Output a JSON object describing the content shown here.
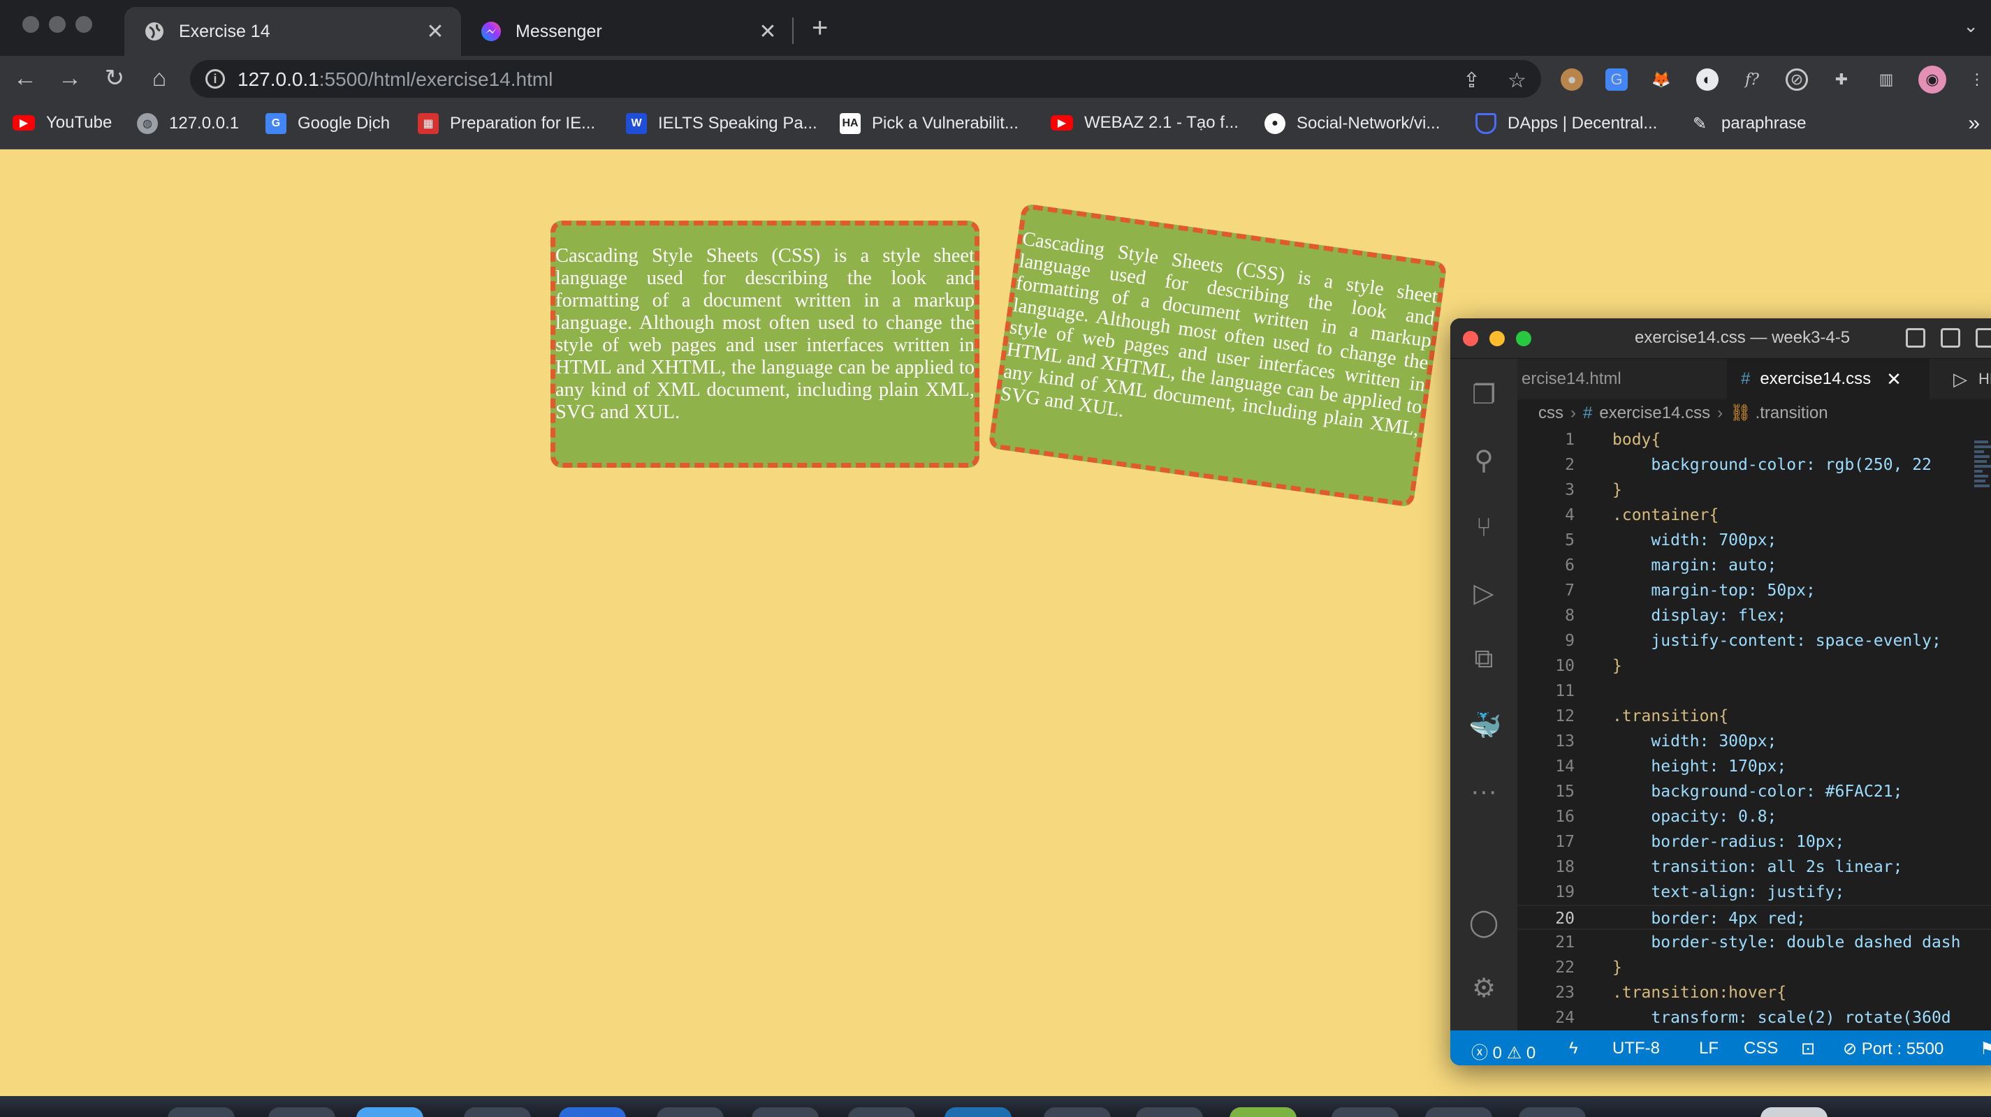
{
  "browser": {
    "tabs": [
      {
        "title": "Exercise 14",
        "icon": "globe-icon",
        "active": true
      },
      {
        "title": "Messenger",
        "icon": "messenger-icon",
        "active": false
      }
    ],
    "url": {
      "host": "127.0.0.1",
      "rest": ":5500/html/exercise14.html"
    },
    "bookmarks": [
      {
        "label": "YouTube",
        "icon": "youtube-icon",
        "color": "#ff0000"
      },
      {
        "label": "127.0.0.1",
        "icon": "globe-icon",
        "color": "#9aa0a6"
      },
      {
        "label": "Google Dịch",
        "icon": "google-translate-icon",
        "color": "#4285f4"
      },
      {
        "label": "Preparation for IE...",
        "icon": "ielts-icon",
        "color": "#d6322f"
      },
      {
        "label": "IELTS Speaking Pa...",
        "icon": "ielts-speaking-icon",
        "color": "#1f4fd8"
      },
      {
        "label": "Pick a Vulnerabilit...",
        "icon": "hacker-icon",
        "color": "#ffffff"
      },
      {
        "label": "WEBAZ 2.1 - Tạo f...",
        "icon": "youtube-icon",
        "color": "#ff0000"
      },
      {
        "label": "Social-Network/vi...",
        "icon": "github-icon",
        "color": "#ffffff"
      },
      {
        "label": "DApps | Decentral...",
        "icon": "shield-icon",
        "color": "#4a6cf7"
      },
      {
        "label": "paraphrase",
        "icon": "pen-icon",
        "color": "#e8eaed"
      }
    ]
  },
  "page": {
    "card_text": "Cascading Style Sheets (CSS) is a style sheet language used for describing the look and formatting of a document written in a markup language. Although most often used to change the style of web pages and user interfaces written in HTML and XHTML, the language can be applied to any kind of XML document, including plain XML, SVG and XUL.",
    "background": "#f6d97e",
    "card_color": "#8fb24a",
    "border_color": "#e05a2e"
  },
  "vscode": {
    "window_title": "exercise14.css — week3-4-5",
    "tabs": [
      {
        "label": "ercise14.html",
        "active": false
      },
      {
        "label": "exercise14.css",
        "active": true
      }
    ],
    "hex_label": "HEX",
    "breadcrumb": {
      "folder": "css",
      "file": "exercise14.css",
      "symbol": ".transition"
    },
    "lines": [
      {
        "n": "1",
        "t": "body{"
      },
      {
        "n": "2",
        "t": "    background-color: rgb(250, 22"
      },
      {
        "n": "3",
        "t": "}"
      },
      {
        "n": "4",
        "t": ".container{"
      },
      {
        "n": "5",
        "t": "    width: 700px;"
      },
      {
        "n": "6",
        "t": "    margin: auto;"
      },
      {
        "n": "7",
        "t": "    margin-top: 50px;"
      },
      {
        "n": "8",
        "t": "    display: flex;"
      },
      {
        "n": "9",
        "t": "    justify-content: space-evenly;"
      },
      {
        "n": "10",
        "t": "}"
      },
      {
        "n": "11",
        "t": ""
      },
      {
        "n": "12",
        "t": ".transition{"
      },
      {
        "n": "13",
        "t": "    width: 300px;"
      },
      {
        "n": "14",
        "t": "    height: 170px;"
      },
      {
        "n": "15",
        "t": "    background-color: #6FAC21;"
      },
      {
        "n": "16",
        "t": "    opacity: 0.8;"
      },
      {
        "n": "17",
        "t": "    border-radius: 10px;"
      },
      {
        "n": "18",
        "t": "    transition: all 2s linear;"
      },
      {
        "n": "19",
        "t": "    text-align: justify;"
      },
      {
        "n": "20",
        "t": "    border: 4px red;"
      },
      {
        "n": "21",
        "t": "    border-style: double dashed dash"
      },
      {
        "n": "22",
        "t": "}"
      },
      {
        "n": "23",
        "t": ".transition:hover{"
      },
      {
        "n": "24",
        "t": "    transform: scale(2) rotate(360d"
      }
    ],
    "status": {
      "errors": "0",
      "warnings": "0",
      "encoding": "UTF-8",
      "eol": "LF",
      "language": "CSS",
      "port": "Port : 5500"
    }
  }
}
